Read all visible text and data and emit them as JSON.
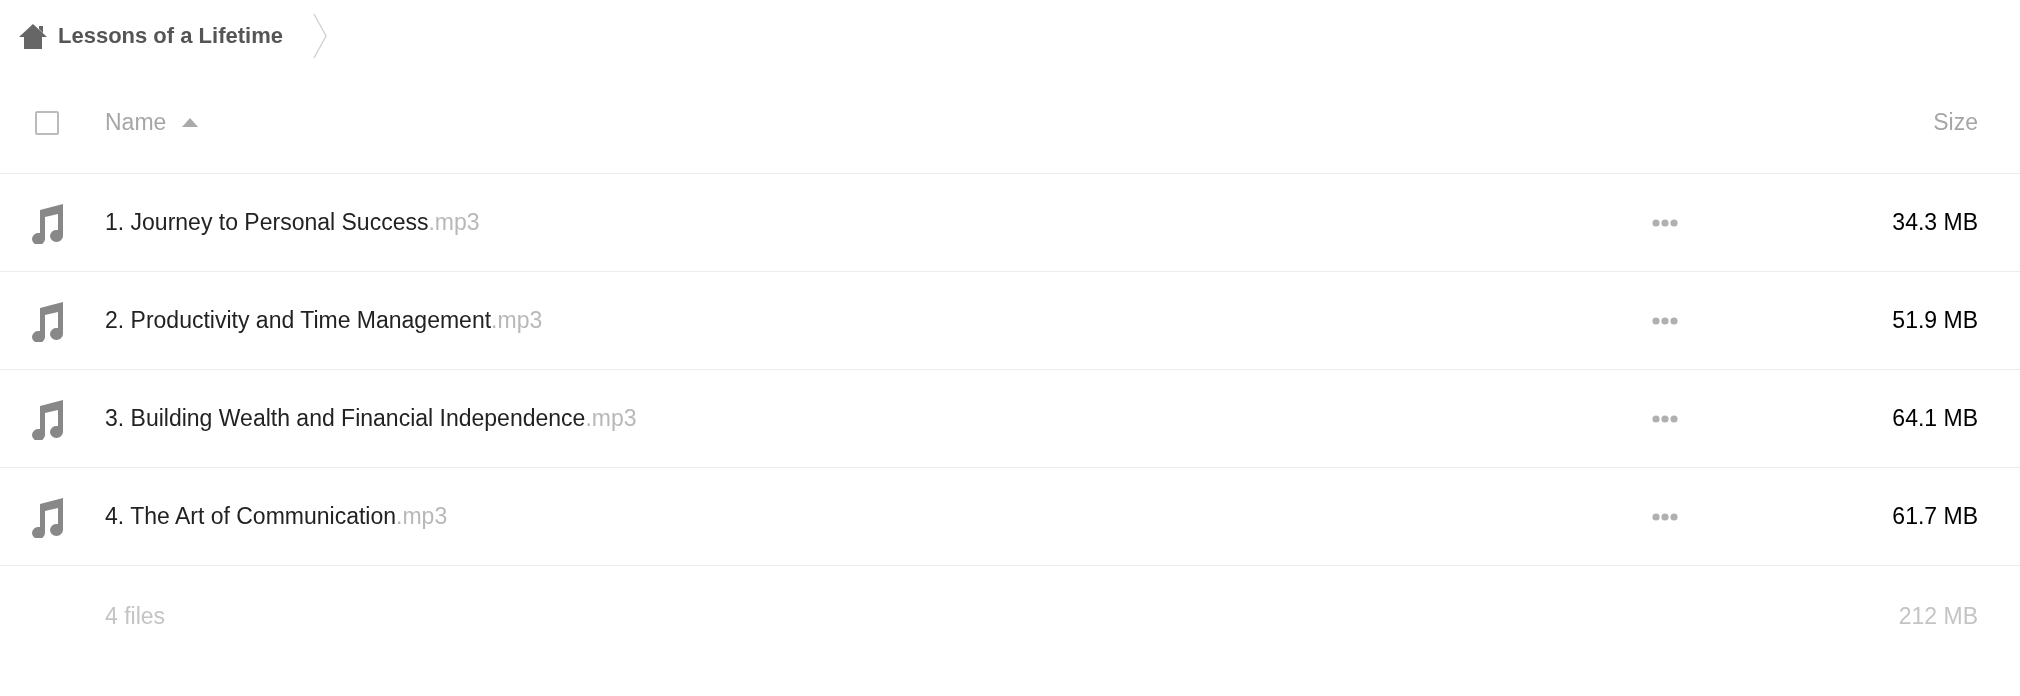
{
  "breadcrumb": {
    "label": "Lessons of a Lifetime"
  },
  "header": {
    "select_all": {
      "checked": false
    },
    "columns": [
      {
        "label": "Name",
        "sorted": true
      },
      {
        "label": "Size",
        "sorted": false
      }
    ]
  },
  "files": [
    {
      "kind": "audio",
      "name": "1. Journey to Personal Success",
      "extension": ".mp3",
      "size": "34.3 MB"
    },
    {
      "kind": "audio",
      "name": "2. Productivity and Time Management",
      "extension": ".mp3",
      "size": "51.9 MB"
    },
    {
      "kind": "audio",
      "name": "3. Building Wealth and Financial Independence",
      "extension": ".mp3",
      "size": "64.1 MB"
    },
    {
      "kind": "audio",
      "name": "4. The Art of Communication",
      "extension": ".mp3",
      "size": "61.7 MB"
    }
  ],
  "summary": {
    "count": "4 files",
    "total": "212 MB"
  }
}
